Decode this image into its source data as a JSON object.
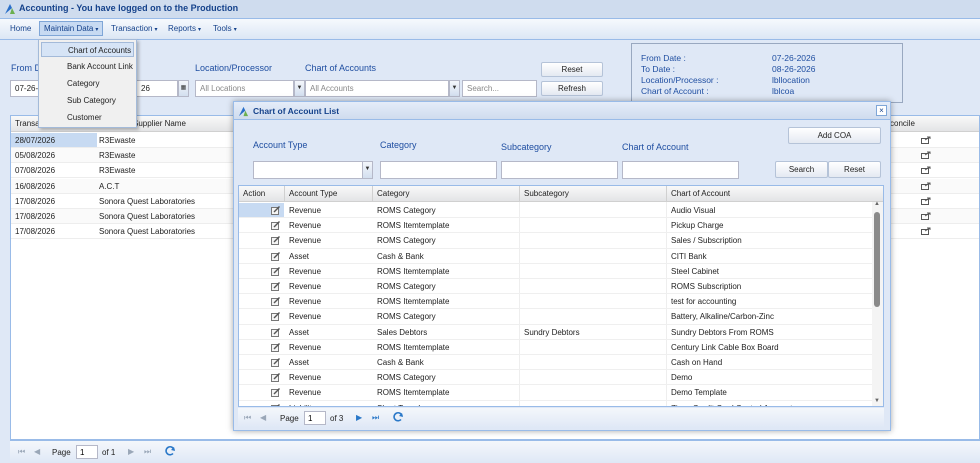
{
  "app": {
    "title": "Accounting - You have logged on to the Production"
  },
  "menubar": {
    "items": [
      {
        "label": "Home",
        "caret": ""
      },
      {
        "label": "Maintain Data",
        "caret": "▾"
      },
      {
        "label": "Transaction",
        "caret": "▾"
      },
      {
        "label": "Reports",
        "caret": "▾"
      },
      {
        "label": "Tools",
        "caret": "▾"
      }
    ]
  },
  "dropdown_menu": {
    "items": [
      "Chart of Accounts",
      "Bank Account Link",
      "Category",
      "Sub Category",
      "Customer"
    ],
    "highlighted": "Chart of Accounts"
  },
  "filters": {
    "from_date_label": "From D",
    "from_date_value": "07-26-2",
    "to_date_value": "26",
    "location_label": "Location/Processor",
    "location_value": "All Locations",
    "coa_label": "Chart of Accounts",
    "coa_value": "All Accounts",
    "search_placeholder": "Search...",
    "reset_label": "Reset",
    "refresh_label": "Refresh"
  },
  "info_box": {
    "rows": [
      {
        "label": "From Date :",
        "value": "07-26-2026"
      },
      {
        "label": "To Date :",
        "value": "08-26-2026"
      },
      {
        "label": "Location/Processor :",
        "value": "lbllocation"
      },
      {
        "label": "Chart of Account :",
        "value": "lblcoa"
      }
    ]
  },
  "main_grid": {
    "headers": {
      "transaction": "Transa",
      "supplier": "Supplier Name",
      "reconcile": "concile"
    },
    "rows": [
      {
        "date": "28/07/2026",
        "supplier": "R3Ewaste"
      },
      {
        "date": "05/08/2026",
        "supplier": "R3Ewaste"
      },
      {
        "date": "07/08/2026",
        "supplier": "R3Ewaste"
      },
      {
        "date": "16/08/2026",
        "supplier": "A.C.T"
      },
      {
        "date": "17/08/2026",
        "supplier": "Sonora Quest Laboratories"
      },
      {
        "date": "17/08/2026",
        "supplier": "Sonora Quest Laboratories"
      },
      {
        "date": "17/08/2026",
        "supplier": "Sonora Quest Laboratories"
      }
    ]
  },
  "main_pager": {
    "page_label": "Page",
    "page_value": "1",
    "of_label": "of 1"
  },
  "modal": {
    "title": "Chart of Account List",
    "close": "×",
    "account_type_label": "Account Type",
    "category_label": "Category",
    "subcategory_label": "Subcategory",
    "coa_label": "Chart of Account",
    "add_coa_label": "Add COA",
    "search_label": "Search",
    "reset_label": "Reset",
    "headers": [
      "Action",
      "Account Type",
      "Category",
      "Subcategory",
      "Chart of Account"
    ],
    "rows": [
      {
        "type": "Revenue",
        "category": "ROMS Category",
        "sub": "",
        "coa": "Audio Visual"
      },
      {
        "type": "Revenue",
        "category": "ROMS Itemtemplate",
        "sub": "",
        "coa": "Pickup Charge"
      },
      {
        "type": "Revenue",
        "category": "ROMS Category",
        "sub": "",
        "coa": "Sales / Subscription"
      },
      {
        "type": "Asset",
        "category": "Cash & Bank",
        "sub": "",
        "coa": "CITI Bank"
      },
      {
        "type": "Revenue",
        "category": "ROMS Itemtemplate",
        "sub": "",
        "coa": "Steel Cabinet"
      },
      {
        "type": "Revenue",
        "category": "ROMS Category",
        "sub": "",
        "coa": "ROMS Subscription"
      },
      {
        "type": "Revenue",
        "category": "ROMS Itemtemplate",
        "sub": "",
        "coa": "test for accounting"
      },
      {
        "type": "Revenue",
        "category": "ROMS Category",
        "sub": "",
        "coa": "Battery, Alkaline/Carbon-Zinc"
      },
      {
        "type": "Asset",
        "category": "Sales Debtors",
        "sub": "Sundry Debtors",
        "coa": "Sundry Debtors From ROMS"
      },
      {
        "type": "Revenue",
        "category": "ROMS Itemtemplate",
        "sub": "",
        "coa": "Century Link Cable Box Board"
      },
      {
        "type": "Asset",
        "category": "Cash & Bank",
        "sub": "",
        "coa": "Cash on Hand"
      },
      {
        "type": "Revenue",
        "category": "ROMS Category",
        "sub": "",
        "coa": "Demo"
      },
      {
        "type": "Revenue",
        "category": "ROMS Itemtemplate",
        "sub": "",
        "coa": "Demo Template"
      },
      {
        "type": "Liability",
        "category": "Short Term Loan",
        "sub": "",
        "coa": "Zions Credit Card Control Account"
      }
    ],
    "pager": {
      "page_label": "Page",
      "page_value": "1",
      "of_label": "of 3"
    }
  },
  "colors": {
    "accent": "#15428b",
    "label_blue": "#1f4ea1",
    "selection": "#c7daf2",
    "panel": "#dfe8f6"
  }
}
